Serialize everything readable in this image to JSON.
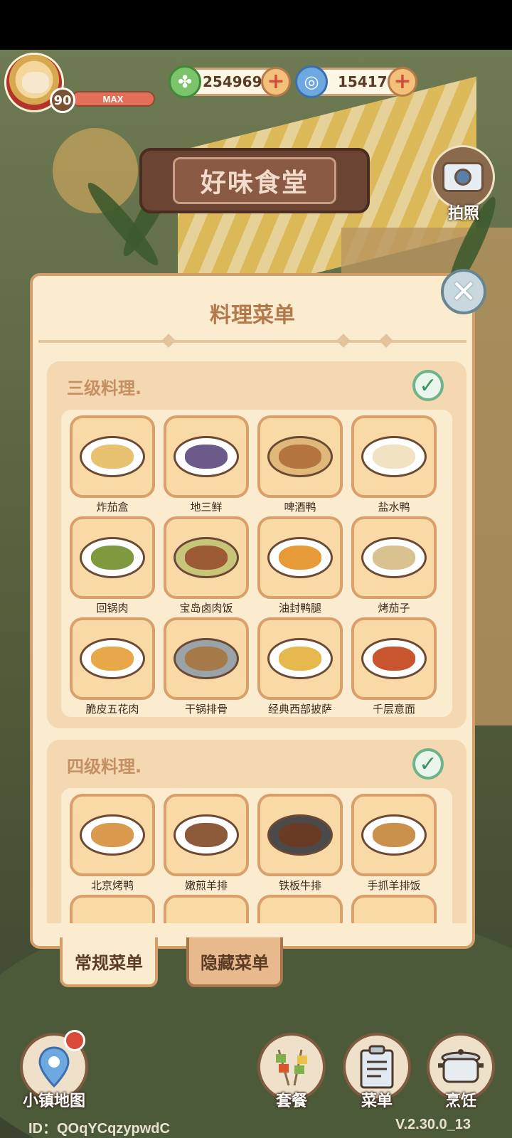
{
  "hud": {
    "level": "90",
    "level_status": "MAX",
    "clover_coins": "254969",
    "swirl_coins": "15417"
  },
  "restaurant": {
    "name": "好味食堂"
  },
  "camera": {
    "label": "拍照"
  },
  "menu_panel": {
    "title": "料理菜单",
    "sections": [
      {
        "title": "三级料理.",
        "dishes": [
          "炸茄盒",
          "地三鲜",
          "啤酒鸭",
          "盐水鸭",
          "回锅肉",
          "宝岛卤肉饭",
          "油封鸭腿",
          "烤茄子",
          "脆皮五花肉",
          "干锅排骨",
          "经典西部披萨",
          "千层意面"
        ]
      },
      {
        "title": "四级料理.",
        "dishes": [
          "北京烤鸭",
          "嫩煎羊排",
          "铁板牛排",
          "手抓羊排饭"
        ]
      }
    ],
    "tabs": {
      "regular": "常规菜单",
      "hidden": "隐藏菜单"
    }
  },
  "bottom_nav": {
    "map": "小镇地图",
    "combo": "套餐",
    "menu": "菜单",
    "cook": "烹饪"
  },
  "footer": {
    "user_id": "ID：QOqYCqzypwdC",
    "version": "V.2.30.0_13"
  }
}
